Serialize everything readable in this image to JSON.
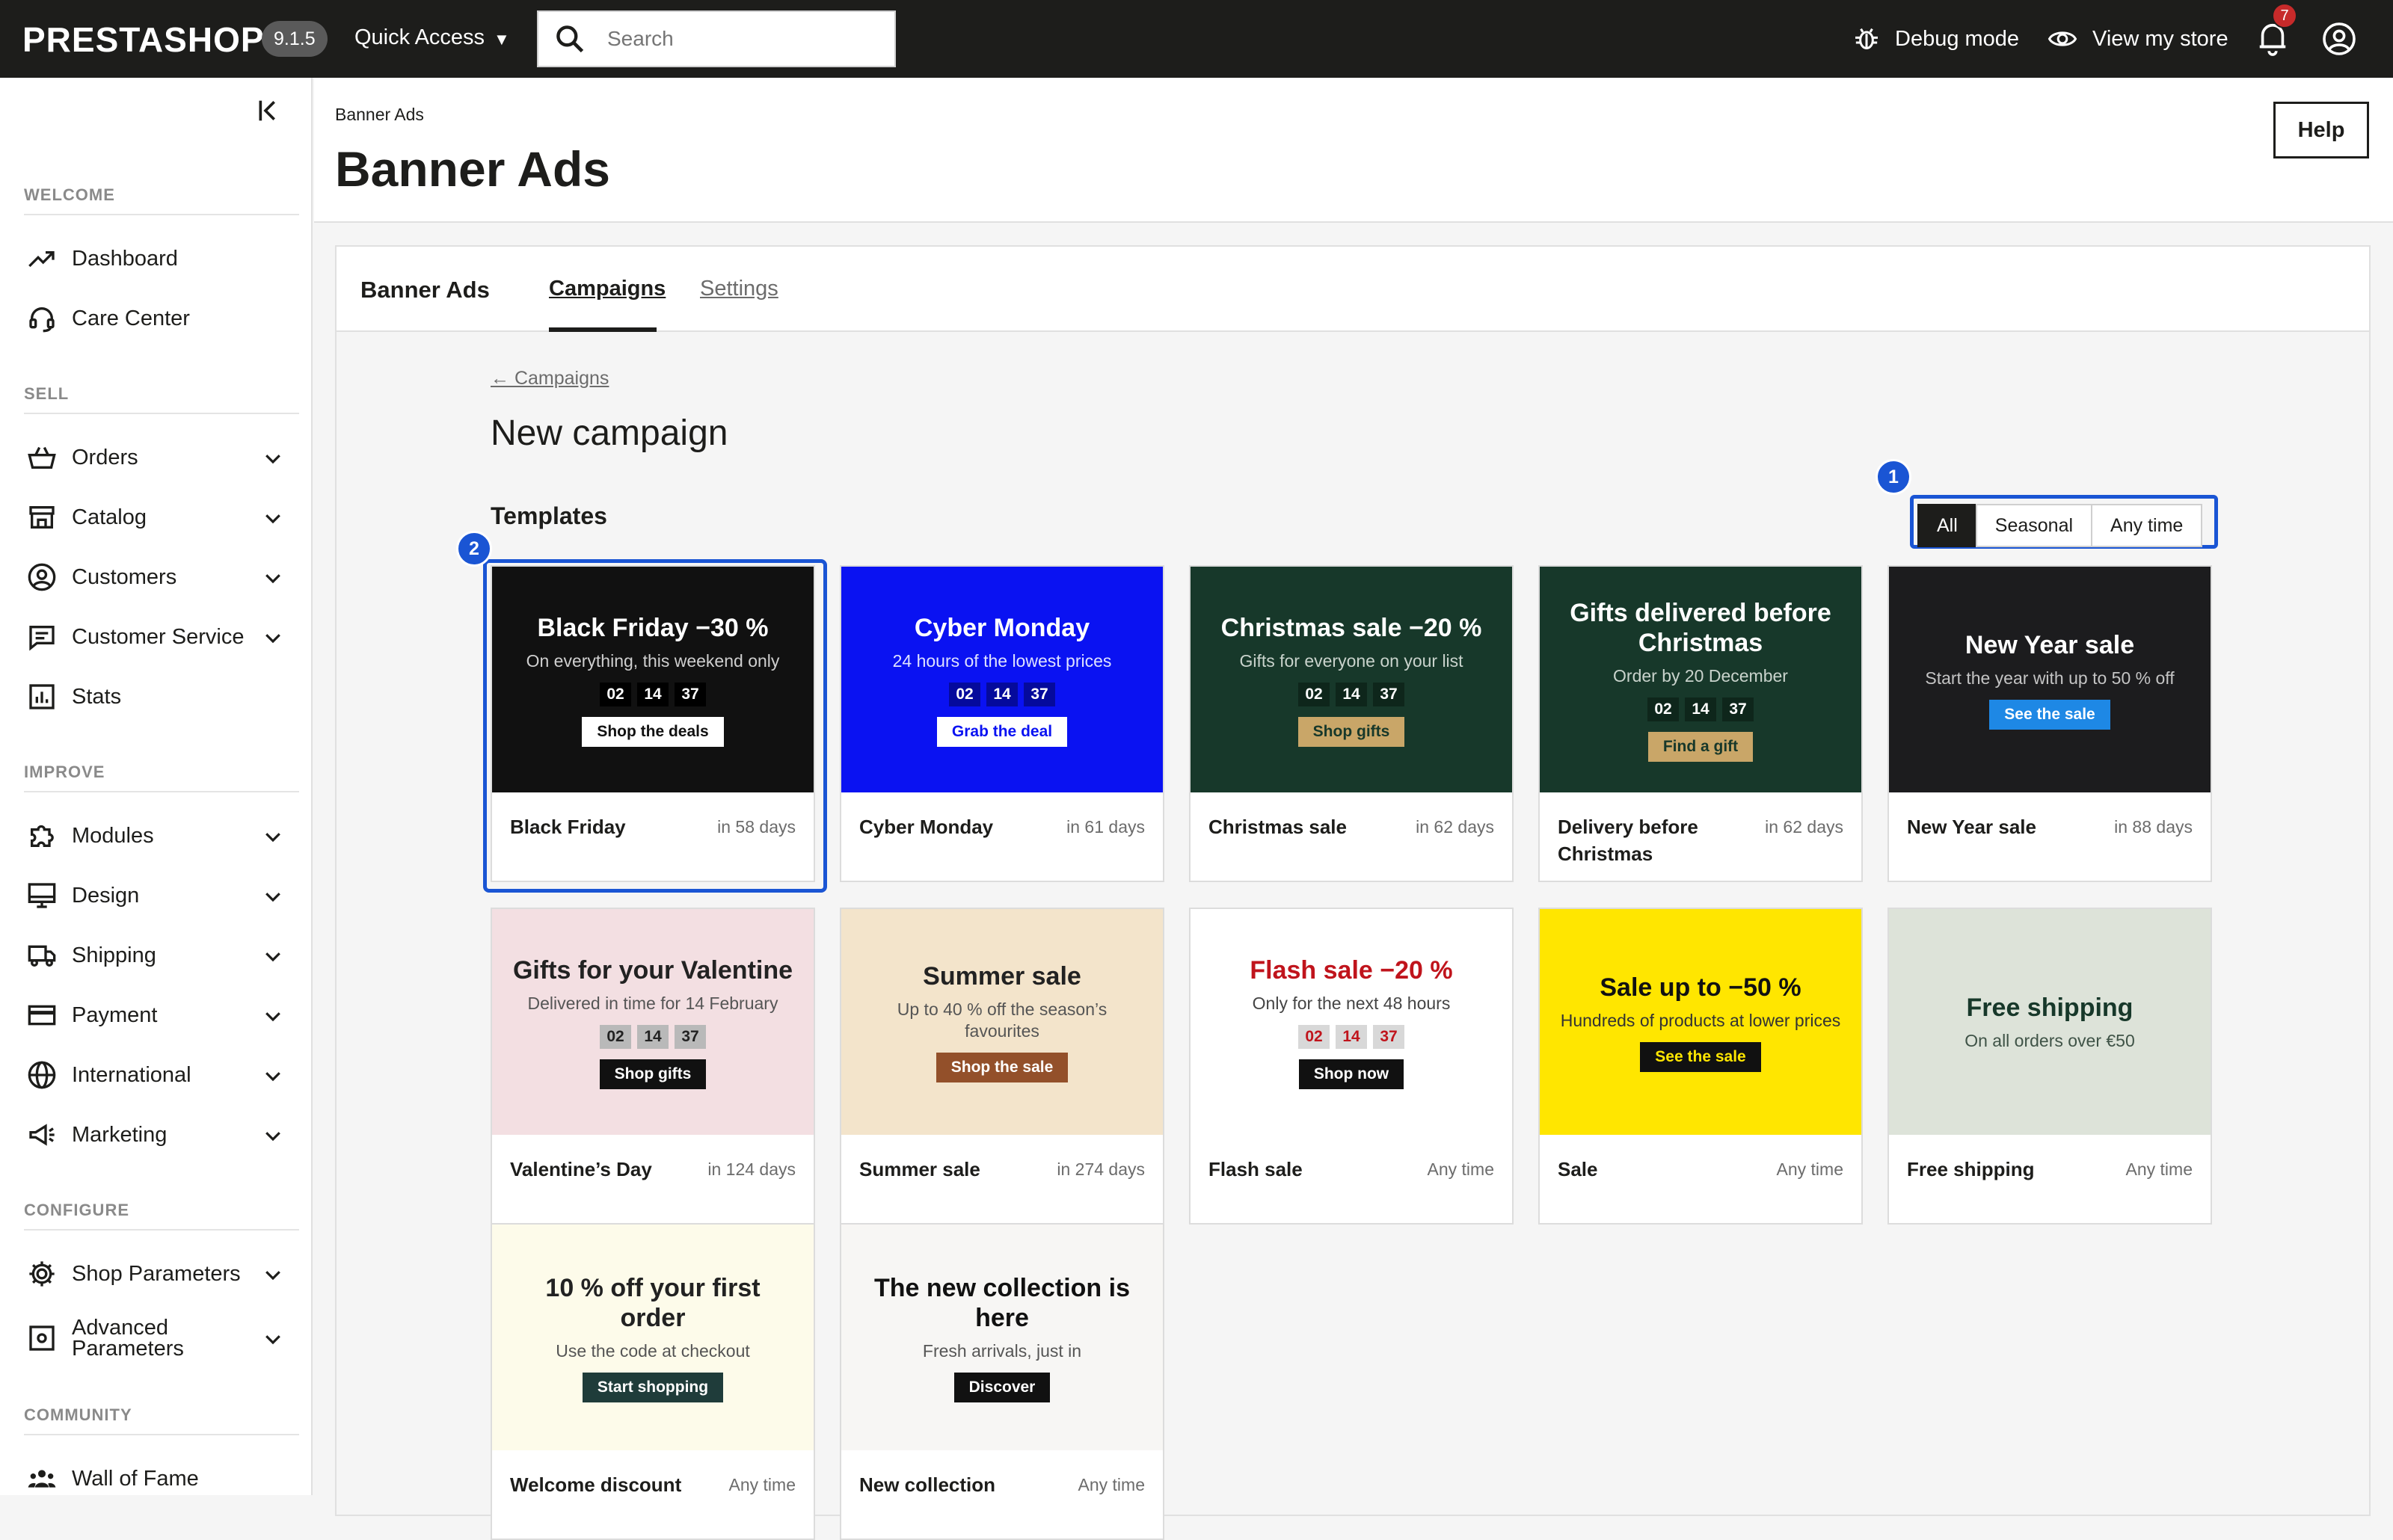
{
  "header": {
    "logo": "PRESTASHOP",
    "version": "9.1.5",
    "quick_access": "Quick Access",
    "search_placeholder": "Search",
    "debug": "Debug mode",
    "view_store": "View my store",
    "notifications": "7"
  },
  "sidebar": {
    "sections": {
      "welcome": "WELCOME",
      "sell": "SELL",
      "improve": "IMPROVE",
      "configure": "CONFIGURE",
      "community": "COMMUNITY"
    },
    "items": {
      "dashboard": "Dashboard",
      "care": "Care Center",
      "orders": "Orders",
      "catalog": "Catalog",
      "customers": "Customers",
      "service": "Customer Service",
      "stats": "Stats",
      "modules": "Modules",
      "design": "Design",
      "shipping": "Shipping",
      "payment": "Payment",
      "international": "International",
      "marketing": "Marketing",
      "shop_params": "Shop Parameters",
      "adv_params": "Advanced Parameters",
      "wall": "Wall of Fame"
    }
  },
  "page": {
    "breadcrumb": "Banner Ads",
    "title": "Banner Ads",
    "help": "Help"
  },
  "module": {
    "name": "Banner Ads",
    "tabs": {
      "campaigns": "Campaigns",
      "settings": "Settings"
    },
    "back": "← Campaigns",
    "heading": "New campaign",
    "templates_label": "Templates",
    "filters": {
      "all": "All",
      "seasonal": "Seasonal",
      "anytime": "Any time"
    },
    "markers": {
      "one": "1",
      "two": "2"
    }
  },
  "countdown": {
    "h": "02",
    "m": "14",
    "s": "37"
  },
  "templates": [
    {
      "headline": "Black Friday −30 %",
      "sub": "On everything, this weekend only",
      "cta": "Shop the deals",
      "name": "Black Friday",
      "when": "in 58 days",
      "bg": "#111111",
      "fg": "#ffffff",
      "subfg": "#cfcfcf",
      "cdbg": "#000000",
      "cdfg": "#ffffff",
      "btnbg": "#ffffff",
      "btnfg": "#111111"
    },
    {
      "headline": "Cyber Monday",
      "sub": "24 hours of the lowest prices",
      "cta": "Grab the deal",
      "name": "Cyber Monday",
      "when": "in 61 days",
      "bg": "#0a12f2",
      "fg": "#ffffff",
      "subfg": "#dfe2ff",
      "cdbg": "#050a9c",
      "cdfg": "#ffffff",
      "btnbg": "#ffffff",
      "btnfg": "#0a12f2"
    },
    {
      "headline": "Christmas sale −20 %",
      "sub": "Gifts for everyone on your list",
      "cta": "Shop gifts",
      "name": "Christmas sale",
      "when": "in 62 days",
      "bg": "#17382a",
      "fg": "#ffffff",
      "subfg": "#c9d3cc",
      "cdbg": "#0e261b",
      "cdfg": "#ffffff",
      "btnbg": "#c9a668",
      "btnfg": "#17382a"
    },
    {
      "headline": "Gifts delivered before Christmas",
      "sub": "Order by 20 December",
      "cta": "Find a gift",
      "name": "Delivery before Christmas",
      "when": "in 62 days",
      "bg": "#17382a",
      "fg": "#ffffff",
      "subfg": "#c9d3cc",
      "cdbg": "#0e261b",
      "cdfg": "#ffffff",
      "btnbg": "#c9a668",
      "btnfg": "#17382a"
    },
    {
      "headline": "New Year sale",
      "sub": "Start the year with up to 50 % off",
      "cta": "See the sale",
      "name": "New Year sale",
      "when": "in 88 days",
      "bg": "#1c1c1e",
      "fg": "#ffffff",
      "subfg": "#c4c4c4",
      "btnbg": "#1e88e5",
      "btnfg": "#ffffff"
    },
    {
      "headline": "Gifts for your Valentine",
      "sub": "Delivered in time for 14 February",
      "cta": "Shop gifts",
      "name": "Valentine’s Day",
      "when": "in 124 days",
      "bg": "#f3dfe2",
      "fg": "#222222",
      "subfg": "#555555",
      "cdbg": "#b9b9b9",
      "cdfg": "#222222",
      "btnbg": "#111111",
      "btnfg": "#ffffff"
    },
    {
      "headline": "Summer sale",
      "sub": "Up to 40 % off the season’s favourites",
      "cta": "Shop the sale",
      "name": "Summer sale",
      "when": "in 274 days",
      "bg": "#f3e4cb",
      "fg": "#222222",
      "subfg": "#555555",
      "btnbg": "#93502a",
      "btnfg": "#ffffff"
    },
    {
      "headline": "Flash sale −20 %",
      "sub": "Only for the next 48 hours",
      "cta": "Shop now",
      "name": "Flash sale",
      "when": "Any time",
      "bg": "#ffffff",
      "fg": "#c0141c",
      "subfg": "#444444",
      "cdbg": "#d8d8d8",
      "cdfg": "#c0141c",
      "btnbg": "#111111",
      "btnfg": "#ffffff"
    },
    {
      "headline": "Sale up to −50 %",
      "sub": "Hundreds of products at lower prices",
      "cta": "See the sale",
      "name": "Sale",
      "when": "Any time",
      "bg": "#ffe600",
      "fg": "#111111",
      "subfg": "#333333",
      "btnbg": "#111111",
      "btnfg": "#ffe600"
    },
    {
      "headline": "Free shipping",
      "sub": "On all orders over €50",
      "cta": "",
      "name": "Free shipping",
      "when": "Any time",
      "bg": "#dde3d9",
      "fg": "#17382a",
      "subfg": "#3f5347"
    },
    {
      "headline": "10 % off your first order",
      "sub": "Use the code at checkout",
      "cta": "Start shopping",
      "name": "Welcome discount",
      "when": "Any time",
      "bg": "#fdfbea",
      "fg": "#222222",
      "subfg": "#555555",
      "btnbg": "#1f3c3a",
      "btnfg": "#ffffff"
    },
    {
      "headline": "The new collection is here",
      "sub": "Fresh arrivals, just in",
      "cta": "Discover",
      "name": "New collection",
      "when": "Any time",
      "bg": "#f7f6f4",
      "fg": "#111111",
      "subfg": "#555555",
      "btnbg": "#111111",
      "btnfg": "#ffffff"
    }
  ]
}
